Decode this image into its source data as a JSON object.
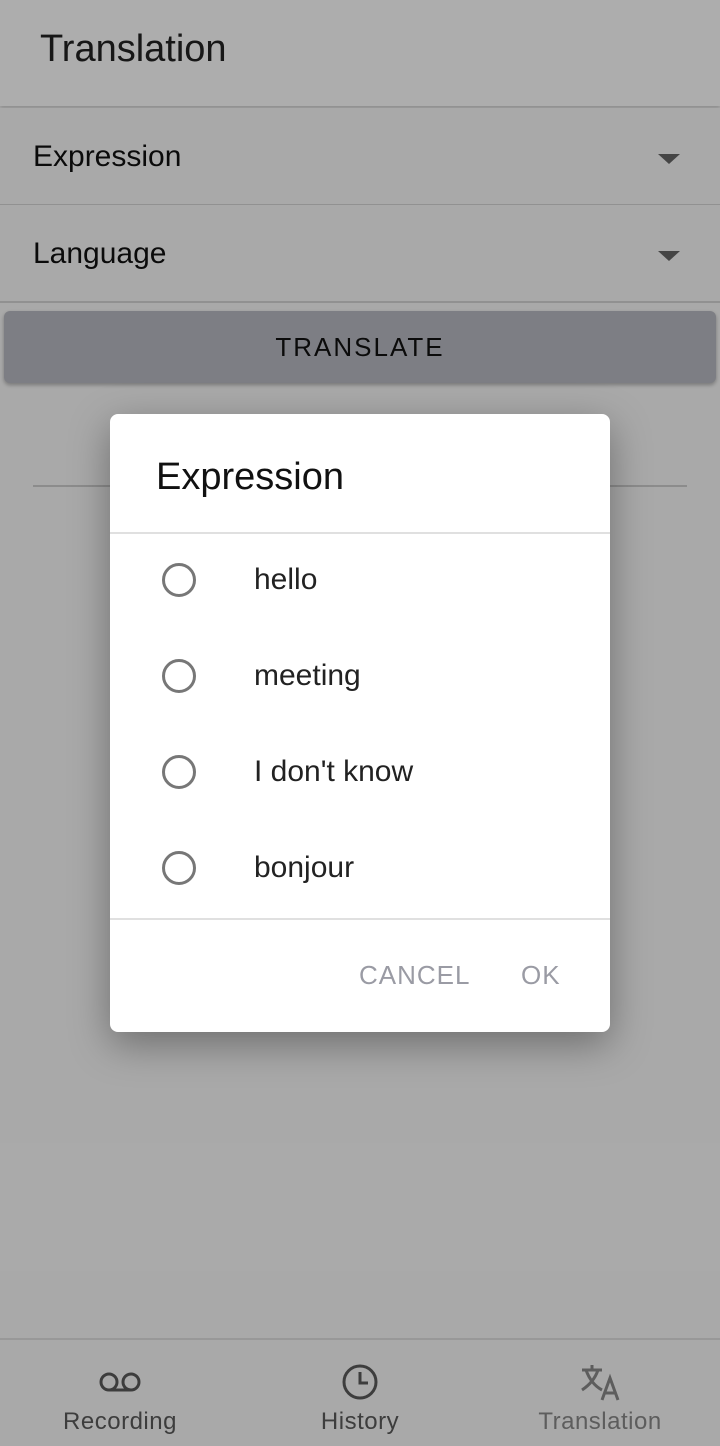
{
  "appbar": {
    "title": "Translation"
  },
  "form": {
    "expression_field": "Expression",
    "language_field": "Language",
    "translate_button": "TRANSLATE"
  },
  "dialog": {
    "title": "Expression",
    "options": [
      {
        "label": "hello",
        "selected": false
      },
      {
        "label": "meeting",
        "selected": false
      },
      {
        "label": "I don't know",
        "selected": false
      },
      {
        "label": "bonjour",
        "selected": false
      }
    ],
    "cancel_label": "CANCEL",
    "ok_label": "OK"
  },
  "bottom_nav": {
    "items": [
      {
        "label": "Recording",
        "icon": "voicemail-icon",
        "active": false
      },
      {
        "label": "History",
        "icon": "clock-icon",
        "active": false
      },
      {
        "label": "Translation",
        "icon": "translate-icon",
        "active": true
      }
    ]
  },
  "colors": {
    "button_bg": "#b9bac3",
    "dialog_action": "#9a9ba4",
    "scrim": "rgba(0,0,0,0.32)"
  }
}
